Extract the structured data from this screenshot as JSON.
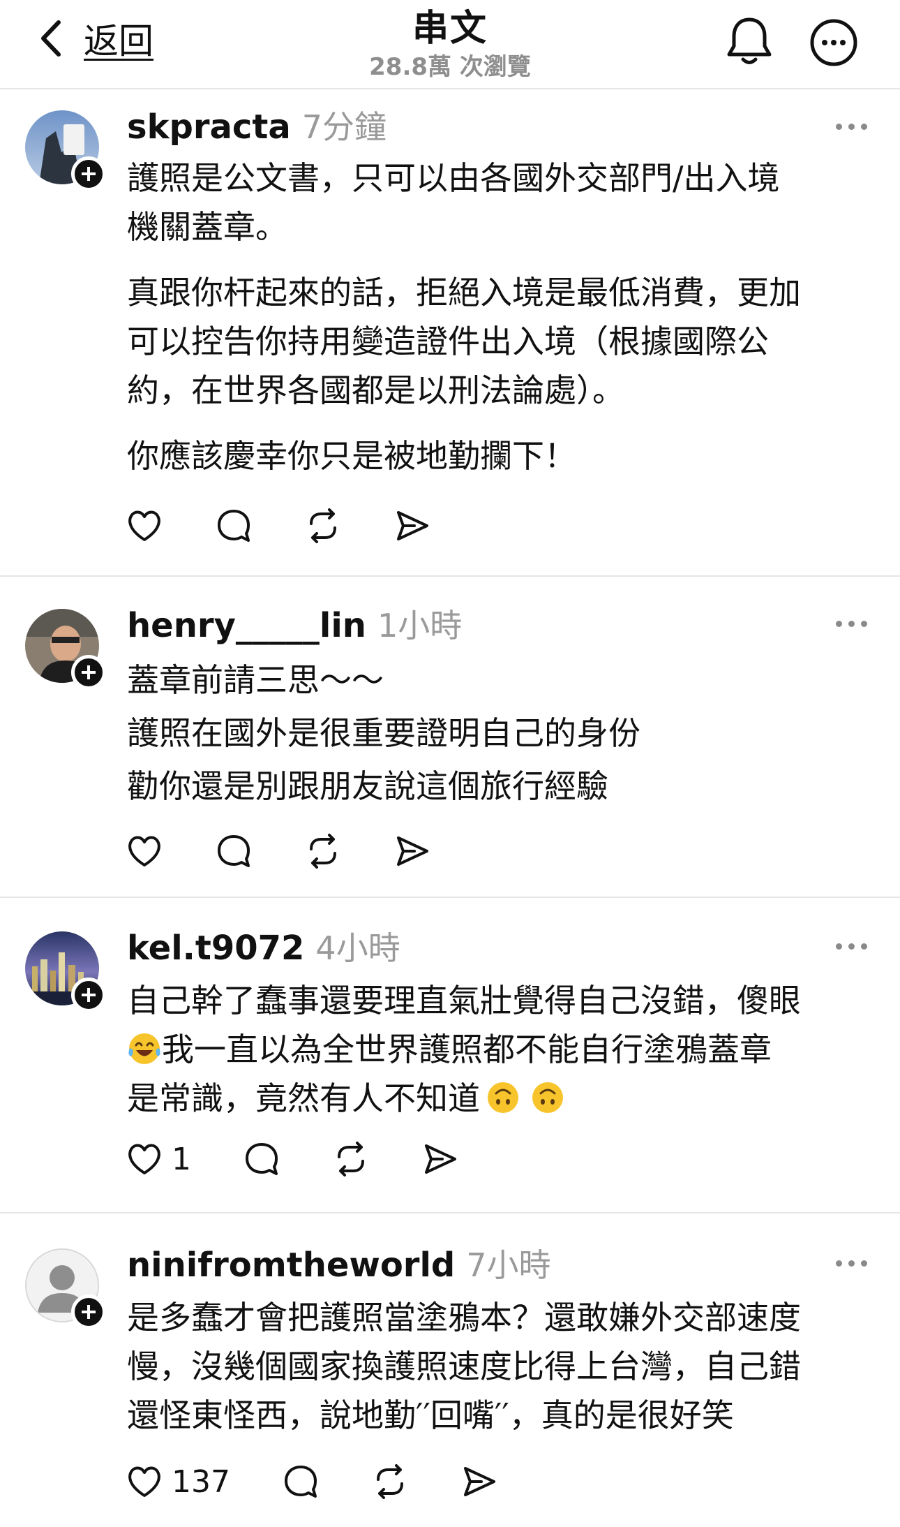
{
  "header": {
    "back_label": "返回",
    "title": "串文",
    "views": "28.8萬 次瀏覽"
  },
  "posts": [
    {
      "username": "skpracta",
      "time": "7分鐘",
      "paragraphs": [
        [
          "護照是公文書，只可以由各國外交部門/出入境",
          "機關蓋章。"
        ],
        [
          "真跟你杆起來的話，拒絕入境是最低消費，更加",
          "可以控告你持用變造證件出入境（根據國際公",
          "約，在世界各國都是以刑法論處）。"
        ],
        [
          "你應該慶幸你只是被地勤攔下！"
        ]
      ],
      "likes": ""
    },
    {
      "username": "henry_____lin",
      "time": "1小時",
      "paragraphs": [
        [
          "蓋章前請三思～～",
          "護照在國外是很重要證明自己的身份",
          "勸你還是別跟朋友說這個旅行經驗"
        ]
      ],
      "likes": ""
    },
    {
      "username": "kel.t9072",
      "time": "4小時",
      "lines": {
        "l1": "自己幹了蠢事還要理直氣壯覺得自己沒錯，傻眼",
        "l2": "我一直以為全世界護照都不能自行塗鴉蓋章",
        "l3": "是常識，竟然有人不知道"
      },
      "emojis": [
        "face-with-tears-of-joy",
        "upside-down-face",
        "upside-down-face"
      ],
      "likes": "1"
    },
    {
      "username": "ninifromtheworld",
      "time": "7小時",
      "paragraphs": [
        [
          "是多蠢才會把護照當塗鴉本？還敢嫌外交部速度",
          "慢，沒幾個國家換護照速度比得上台灣，自己錯",
          "還怪東怪西，說地勤′′回嘴′′，真的是很好笑"
        ]
      ],
      "likes": "137"
    }
  ],
  "icons": [
    "chevron-left-icon",
    "bell-icon",
    "more-circle-icon",
    "more-dots-icon",
    "heart-icon",
    "comment-icon",
    "repost-icon",
    "share-icon",
    "follow-plus-icon"
  ],
  "colors": {
    "text": "#111111",
    "muted": "#9a9a9a",
    "divider": "#e6e6e6"
  }
}
